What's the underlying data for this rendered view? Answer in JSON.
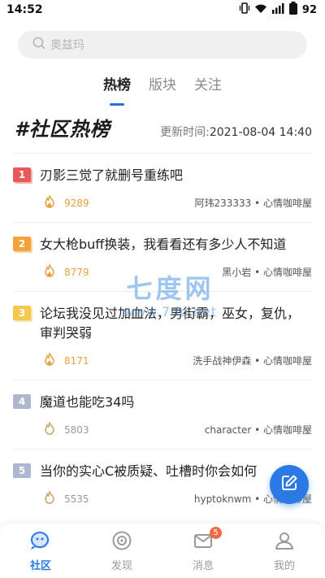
{
  "status_bar": {
    "time": "14:52",
    "battery": "92"
  },
  "search": {
    "placeholder": "奥兹玛"
  },
  "tabs": [
    {
      "label": "热榜",
      "active": true
    },
    {
      "label": "版块",
      "active": false
    },
    {
      "label": "关注",
      "active": false
    }
  ],
  "board": {
    "title": "#社区热榜",
    "update_label": "更新时间:",
    "update_time": "2021-08-04 14:40"
  },
  "posts": [
    {
      "rank": "1",
      "title": "刃影三觉了就删号重练吧",
      "heat": "9289",
      "author": "阿玮233333 • 心情咖啡屋"
    },
    {
      "rank": "2",
      "title": "女大枪buff换装，我看看还有多少人不知道",
      "heat": "8779",
      "author": "黑小岩 • 心情咖啡屋"
    },
    {
      "rank": "3",
      "title": "论坛我没见过加血法，男街霸，巫女，复仇，审判哭弱",
      "heat": "8171",
      "author": "洗手战神伊森 • 心情咖啡屋"
    },
    {
      "rank": "4",
      "title": "魔道也能吃34吗",
      "heat": "5803",
      "author": "character • 心情咖啡屋"
    },
    {
      "rank": "5",
      "title": "当你的实心C被质疑、吐槽时你会如何",
      "heat": "5535",
      "author": "hyptoknwm • 心情咖啡屋"
    }
  ],
  "watermark": {
    "main": "七度网",
    "url": "www.7do.net"
  },
  "bottom_nav": [
    {
      "label": "社区",
      "active": true
    },
    {
      "label": "发现",
      "active": false
    },
    {
      "label": "消息",
      "active": false,
      "badge": "5"
    },
    {
      "label": "我的",
      "active": false
    }
  ],
  "colors": {
    "accent": "#2b79e4",
    "hot": "#e5a13a",
    "badge": "#ee6b42"
  }
}
